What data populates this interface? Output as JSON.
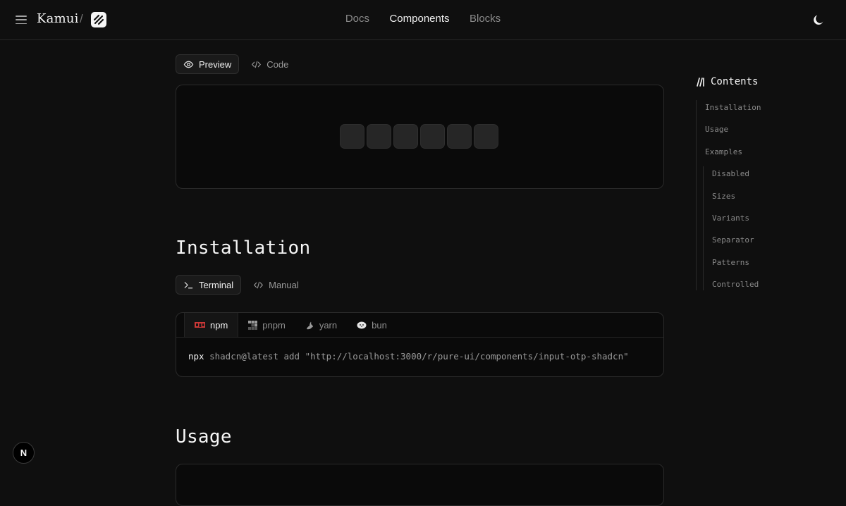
{
  "header": {
    "brand": "Kamui",
    "separator": "/",
    "nav": [
      {
        "label": "Docs",
        "active": false
      },
      {
        "label": "Components",
        "active": true
      },
      {
        "label": "Blocks",
        "active": false
      }
    ]
  },
  "preview_tabs": [
    {
      "label": "Preview",
      "icon": "eye-icon",
      "active": true
    },
    {
      "label": "Code",
      "icon": "code-icon",
      "active": false
    }
  ],
  "otp": {
    "slot_count": 6
  },
  "installation": {
    "title": "Installation",
    "tabs": [
      {
        "label": "Terminal",
        "icon": "terminal-icon",
        "active": true
      },
      {
        "label": "Manual",
        "icon": "code-icon",
        "active": false
      }
    ],
    "package_managers": [
      {
        "label": "npm",
        "icon": "npm-icon",
        "active": true
      },
      {
        "label": "pnpm",
        "icon": "pnpm-icon",
        "active": false
      },
      {
        "label": "yarn",
        "icon": "yarn-icon",
        "active": false
      },
      {
        "label": "bun",
        "icon": "bun-icon",
        "active": false
      }
    ],
    "command_bin": "npx",
    "command_args": "shadcn@latest add \"http://localhost:3000/r/pure-ui/components/input-otp-shadcn\""
  },
  "usage": {
    "title": "Usage"
  },
  "toc": {
    "title": "Contents",
    "items": [
      {
        "label": "Installation",
        "level": 1
      },
      {
        "label": "Usage",
        "level": 1
      },
      {
        "label": "Examples",
        "level": 1
      },
      {
        "label": "Disabled",
        "level": 2
      },
      {
        "label": "Sizes",
        "level": 2
      },
      {
        "label": "Variants",
        "level": 2
      },
      {
        "label": "Separator",
        "level": 2
      },
      {
        "label": "Patterns",
        "level": 2
      },
      {
        "label": "Controlled",
        "level": 2
      }
    ]
  },
  "dev_badge": {
    "label": "N"
  },
  "colors": {
    "background": "#0f0f0f",
    "panel": "#0a0a0a",
    "border": "#2a2a2a",
    "npm_red": "#cb3837"
  }
}
